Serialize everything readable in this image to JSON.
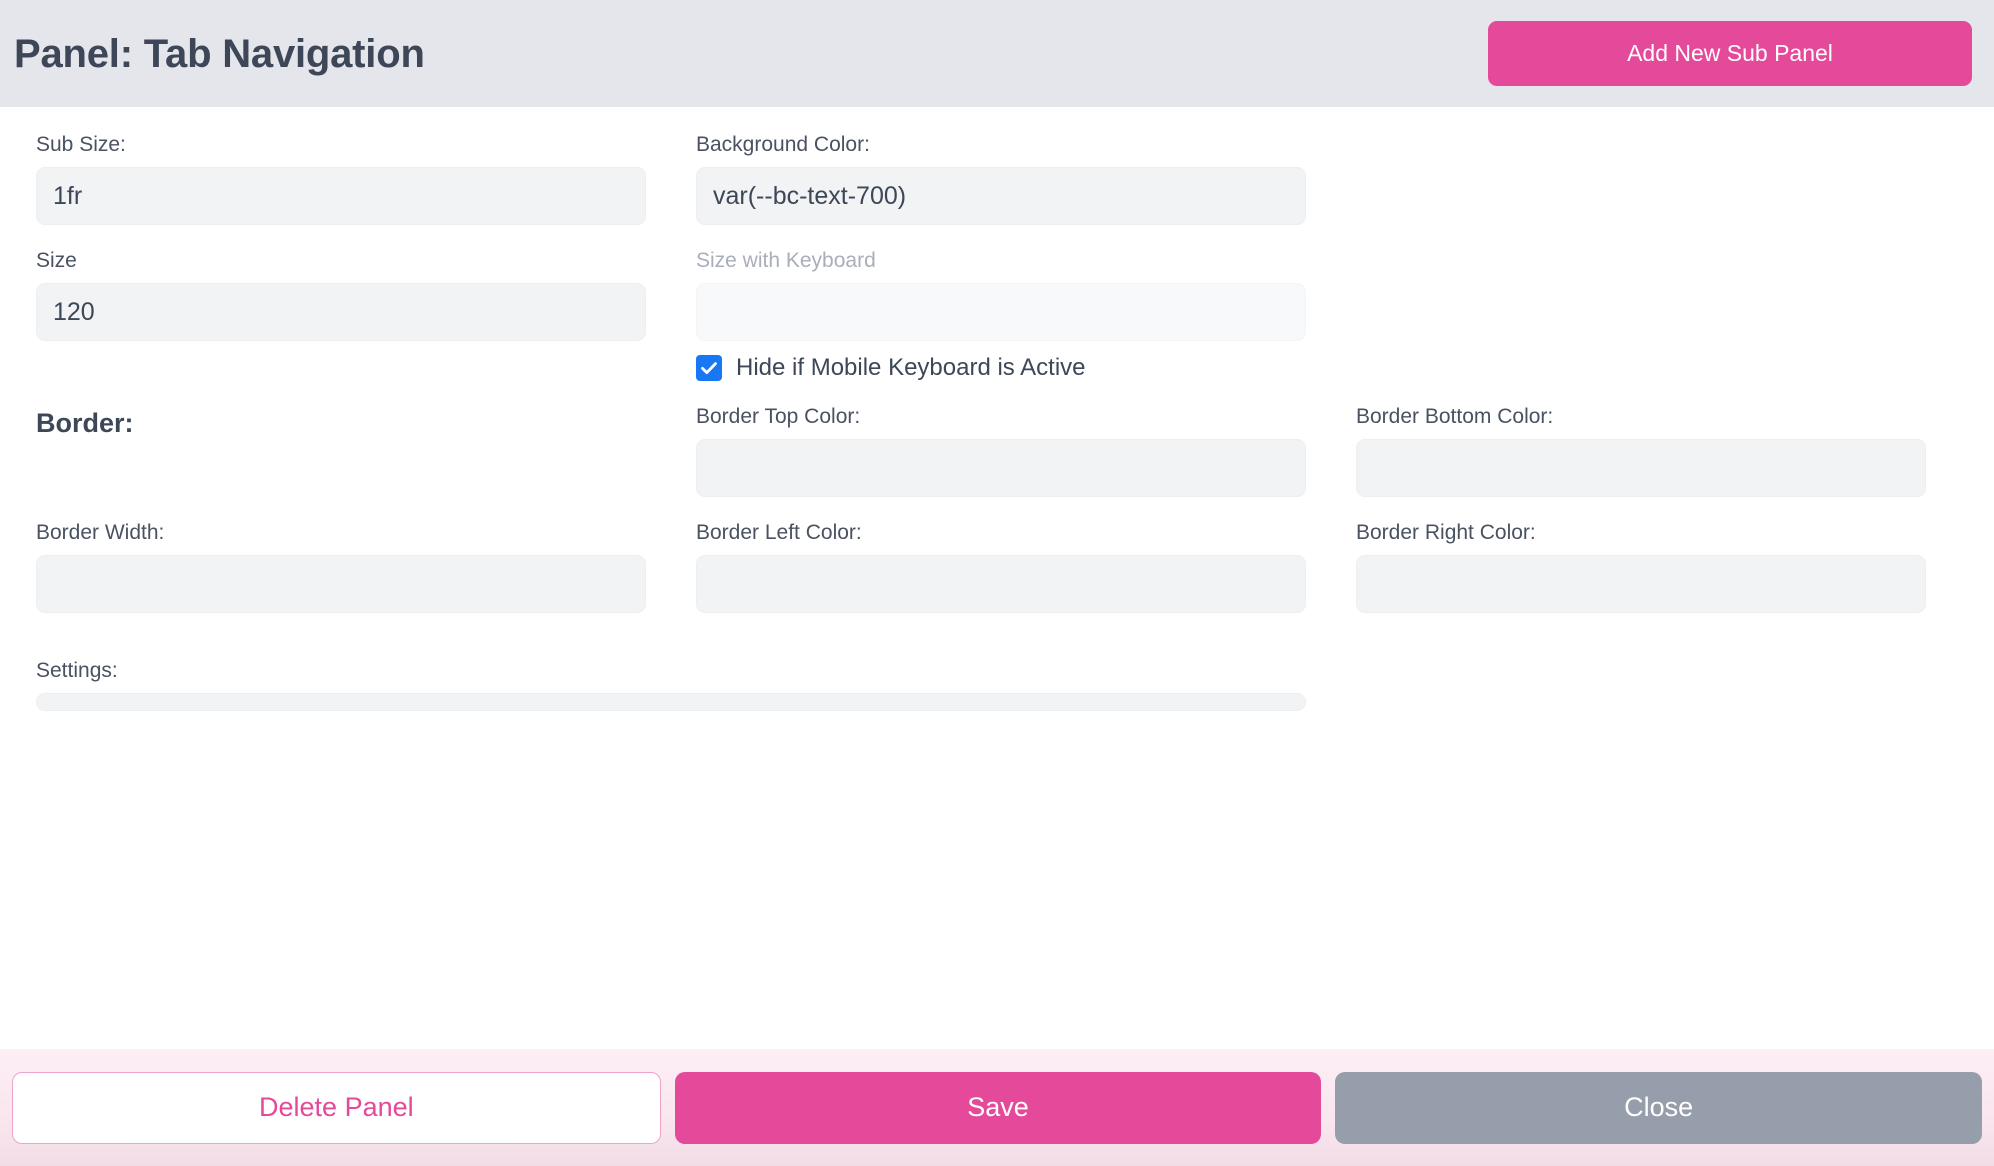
{
  "header": {
    "title": "Panel: Tab Navigation",
    "add_button_label": "Add New Sub Panel"
  },
  "form": {
    "sub_size": {
      "label": "Sub Size:",
      "value": "1fr",
      "placeholder": ""
    },
    "background_color": {
      "label": "Background Color:",
      "value": "var(--bc-text-700)",
      "placeholder": ""
    },
    "size": {
      "label": "Size",
      "value": "120",
      "placeholder": ""
    },
    "size_with_keyboard": {
      "label": "Size with Keyboard",
      "value": "",
      "placeholder": ""
    },
    "hide_if_mobile_keyboard": {
      "label": "Hide if Mobile Keyboard is Active",
      "checked": true
    },
    "border_heading": "Border:",
    "border_top_color": {
      "label": "Border Top Color:",
      "value": "",
      "placeholder": ""
    },
    "border_bottom_color": {
      "label": "Border Bottom Color:",
      "value": "",
      "placeholder": ""
    },
    "border_width": {
      "label": "Border Width:",
      "value": "",
      "placeholder": ""
    },
    "border_left_color": {
      "label": "Border Left Color:",
      "value": "",
      "placeholder": ""
    },
    "border_right_color": {
      "label": "Border Right Color:",
      "value": "",
      "placeholder": ""
    },
    "settings": {
      "label": "Settings:",
      "value": ""
    }
  },
  "footer": {
    "delete_label": "Delete Panel",
    "save_label": "Save",
    "close_label": "Close"
  },
  "colors": {
    "accent_pink": "#e4499a",
    "header_bg": "#e4e6eb",
    "close_gray": "#969dab",
    "checkbox_blue": "#1878f3",
    "footer_bg": "#fbe9f2",
    "input_bg": "#f1f3f5",
    "text_dark": "#3d4758",
    "text_muted": "#a9aeb9"
  }
}
